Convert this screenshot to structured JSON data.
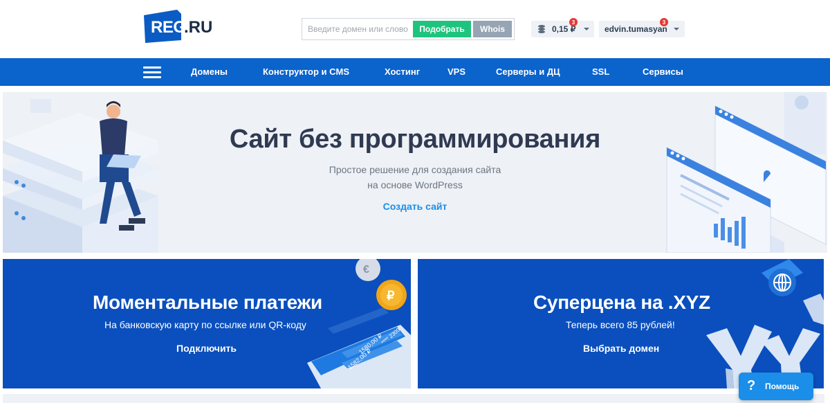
{
  "header": {
    "logo_text": "REG",
    "logo_suffix": ".RU",
    "search_placeholder": "Введите домен или слово",
    "pick_button": "Подобрать",
    "whois_button": "Whois",
    "balance": "0,15 ₽",
    "balance_badge": "3",
    "user_name": "edvin.tumasyan",
    "user_badge": "3"
  },
  "nav": {
    "items": [
      "Домены",
      "Конструктор и CMS",
      "Хостинг",
      "VPS",
      "Серверы и ДЦ",
      "SSL",
      "Сервисы"
    ]
  },
  "hero": {
    "title": "Сайт без программирования",
    "subtitle_line1": "Простое решение для создания сайта",
    "subtitle_line2": "на основе WordPress",
    "cta": "Создать сайт"
  },
  "promo_cards": [
    {
      "title": "Моментальные платежи",
      "subtitle": "На банковскую карту по ссылке или QR-коду",
      "cta": "Подключить",
      "phone_amounts": [
        "1580,00 ₽",
        "1582,00 ₽",
        "**** 2309"
      ]
    },
    {
      "title": "Суперцена на .XYZ",
      "subtitle": "Теперь всего 85 рублей!",
      "cta": "Выбрать домен"
    }
  ],
  "help": {
    "icon": "?",
    "label": "Помощь"
  },
  "colors": {
    "brand_blue": "#0b63cc",
    "card_blue": "#0a4fbd",
    "green": "#1ec47e",
    "hero_bg": "#eef1f5"
  }
}
